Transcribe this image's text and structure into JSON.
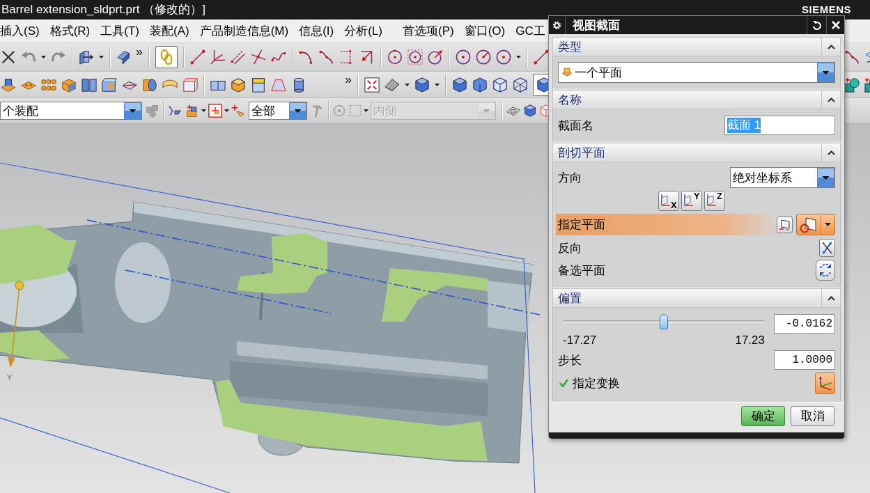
{
  "window": {
    "title": "Barrel extension_sldprt.prt （修改的）]",
    "brand": "SIEMENS"
  },
  "menu": [
    "插入(S)",
    "格式(R)",
    "工具(T)",
    "装配(A)",
    "产品制造信息(M)",
    "信息(I)",
    "分析(L)",
    "首选项(P)",
    "窗口(O)",
    "GC工"
  ],
  "toolbars": {
    "toggles": [
      {
        "selected": true
      },
      {
        "selected": true
      }
    ],
    "assembly_filter": {
      "value": "个装配",
      "disabled": false
    },
    "selection_filter": {
      "value": "全部",
      "disabled": false
    },
    "side_filter": {
      "value": "内侧",
      "disabled": true
    }
  },
  "viewport": {
    "axis_label": "Y"
  },
  "dialog": {
    "title": "视图截面",
    "sections": [
      {
        "title": "类型",
        "expanded": true,
        "rows": [
          {
            "kind": "type",
            "value": "一个平面"
          }
        ]
      },
      {
        "title": "名称",
        "expanded": true,
        "rows": [
          {
            "kind": "field",
            "label": "截面名",
            "value": "截面 1",
            "text_selected": true
          }
        ]
      },
      {
        "title": "剖切平面",
        "expanded": true,
        "rows": [
          {
            "kind": "dropdown",
            "label": "方向",
            "value": "绝对坐标系"
          },
          {
            "kind": "axes",
            "buttons": [
              "X",
              "Y",
              "Z"
            ]
          },
          {
            "kind": "plane",
            "label": "指定平面",
            "active": true
          },
          {
            "kind": "reverse",
            "label": "反向"
          },
          {
            "kind": "cycle",
            "label": "备选平面"
          }
        ]
      },
      {
        "title": "偏置",
        "expanded": true,
        "rows": [
          {
            "kind": "slider",
            "level": 0.5,
            "min": "-17.27",
            "max": "17.23",
            "value": "-0.0162"
          },
          {
            "kind": "number",
            "label": "步长",
            "value": "1.0000"
          },
          {
            "kind": "transform",
            "label": "指定变换",
            "checked": true
          }
        ]
      }
    ],
    "buttons": [
      {
        "label": "确定",
        "highlighted": true
      },
      {
        "label": "取消",
        "highlighted": false
      }
    ]
  }
}
